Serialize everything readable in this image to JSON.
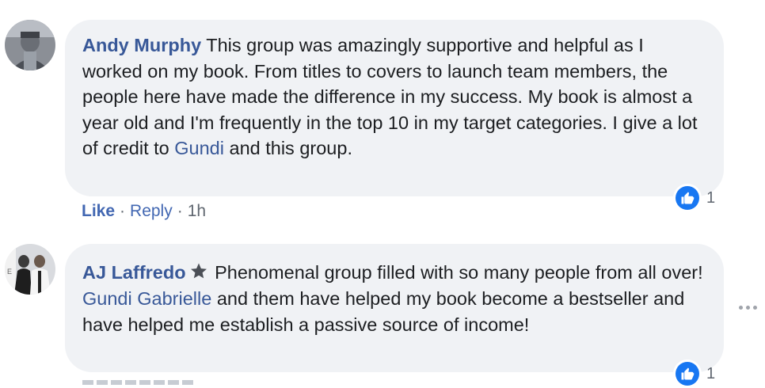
{
  "comments": [
    {
      "author": "Andy Murphy",
      "text_before": " This group was amazingly supportive and helpful as I worked on my book. From titles to covers to launch team members, the people here have made the difference in my success. My book is almost a year old and I'm frequently in the top 10 in my target categories. I give a lot of credit to ",
      "mention": "Gundi",
      "text_after": " and this group.",
      "reaction_icon": "thumbs-up-icon",
      "reaction_count": "1",
      "actions": {
        "like": "Like",
        "separator": "·",
        "reply": "Reply",
        "time": "1h"
      }
    },
    {
      "author": "AJ Laffredo",
      "badge_icon": "star-badge-icon",
      "text_before": " Phenomenal group filled with so many people from all over! ",
      "mention": "Gundi Gabrielle",
      "text_after": " and them have helped my book become a bestseller and have helped me establish a passive source of income!",
      "reaction_icon": "thumbs-up-icon",
      "reaction_count": "1"
    }
  ],
  "more_options_icon": "more-options-icon",
  "colors": {
    "author": "#385898",
    "bubble": "#f0f2f5",
    "like_blue": "#1877f2",
    "meta_gray": "#606770"
  }
}
